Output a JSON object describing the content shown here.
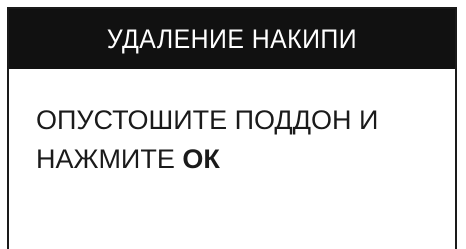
{
  "header": {
    "title": "УДАЛЕНИЕ НАКИПИ"
  },
  "message": {
    "line1": "ОПУСТОШИТЕ ПОДДОН И",
    "line2_prefix": "НАЖМИТЕ ",
    "line2_key": "ОК"
  },
  "colors": {
    "header_background": "#111111",
    "header_text": "#ffffff",
    "body_background": "#ffffff",
    "body_text": "#1a1a1a"
  }
}
